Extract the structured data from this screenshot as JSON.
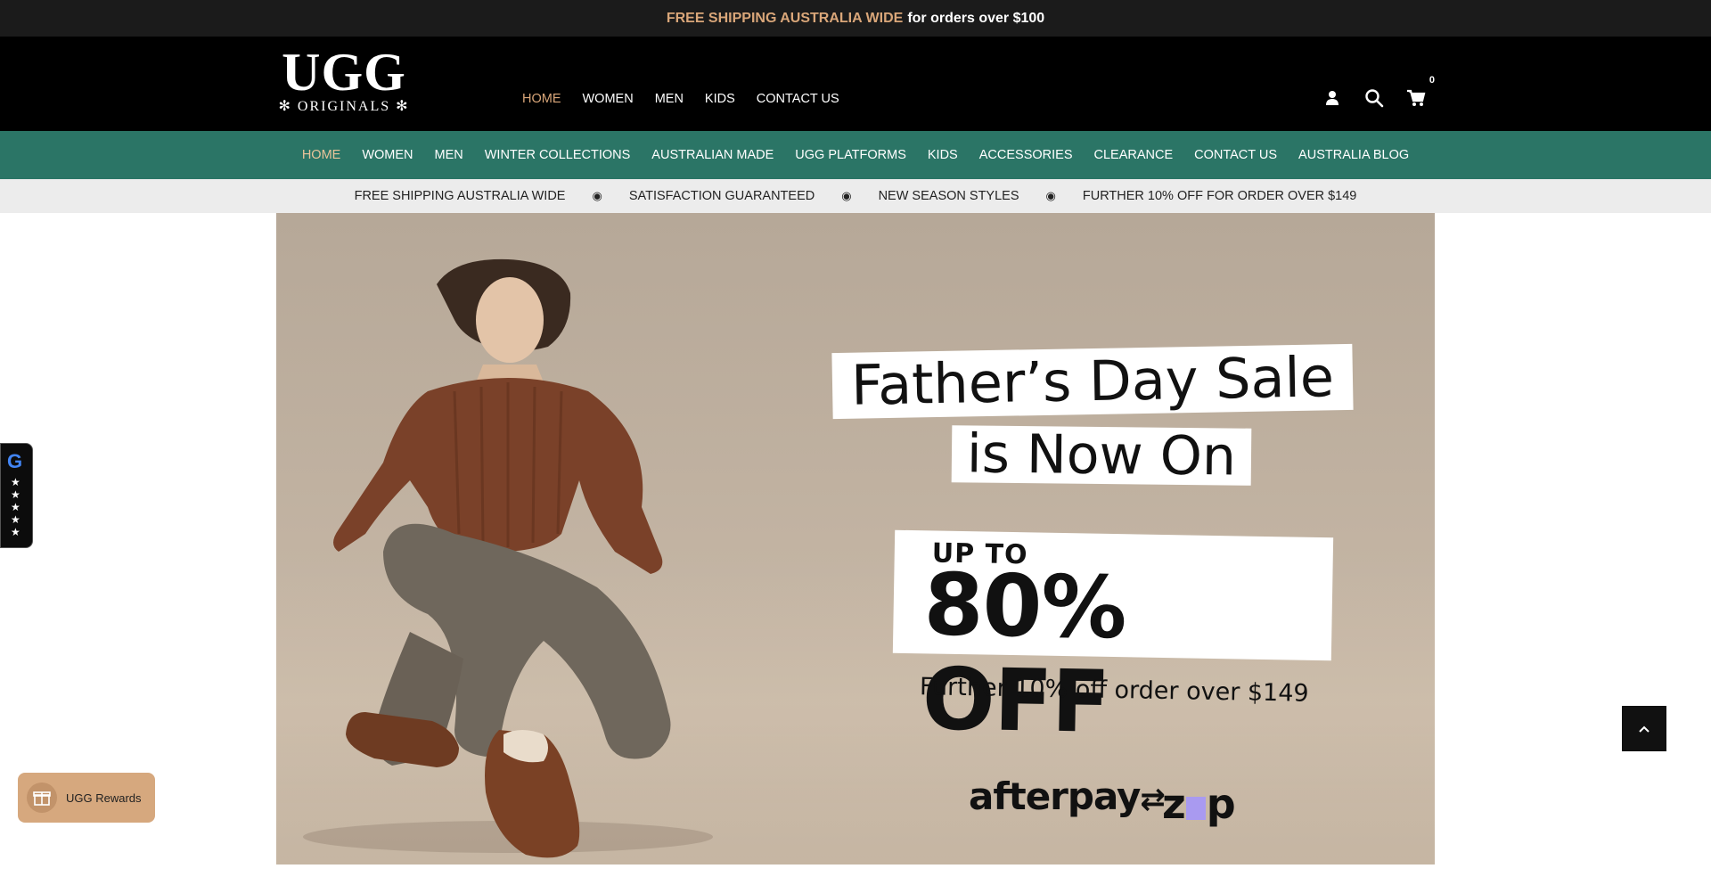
{
  "announcement": {
    "highlight": "FREE SHIPPING AUSTRALIA WIDE",
    "rest": "for orders over $100"
  },
  "logo": {
    "line1": "UGG",
    "line2": "ORIGINALS"
  },
  "main_nav": [
    {
      "label": "HOME",
      "active": true
    },
    {
      "label": "WOMEN"
    },
    {
      "label": "MEN"
    },
    {
      "label": "KIDS"
    },
    {
      "label": "CONTACT US"
    }
  ],
  "header_icons": {
    "account": "user-icon",
    "search": "search-icon",
    "cart": "cart-icon",
    "cart_count": "0"
  },
  "sub_nav": [
    {
      "label": "HOME",
      "active": true
    },
    {
      "label": "WOMEN"
    },
    {
      "label": "MEN"
    },
    {
      "label": "WINTER COLLECTIONS"
    },
    {
      "label": "AUSTRALIAN MADE"
    },
    {
      "label": "UGG PLATFORMS"
    },
    {
      "label": "KIDS"
    },
    {
      "label": "ACCESSORIES"
    },
    {
      "label": "CLEARANCE"
    },
    {
      "label": "CONTACT US"
    },
    {
      "label": "AUSTRALIA BLOG"
    }
  ],
  "benefits": [
    "FREE SHIPPING AUSTRALIA WIDE",
    "SATISFACTION GUARANTEED",
    "NEW SEASON STYLES",
    "FURTHER 10% OFF FOR ORDER OVER $149"
  ],
  "benefit_separator": "◉",
  "hero": {
    "line1": "Father’s Day Sale",
    "line2": "is Now On",
    "upto": "UP TO",
    "percent": "80% OFF",
    "further": "Further 10% off order over $149",
    "payment1": "afterpay",
    "payment2_a": "z",
    "payment2_b": "p"
  },
  "review_widget": {
    "brand": "G",
    "stars": "★\n★\n★\n★\n★"
  },
  "rewards": {
    "label": "UGG Rewards"
  },
  "colors": {
    "accent": "#d9a679",
    "green_bar": "#2b7566",
    "header_bg": "#000000"
  }
}
